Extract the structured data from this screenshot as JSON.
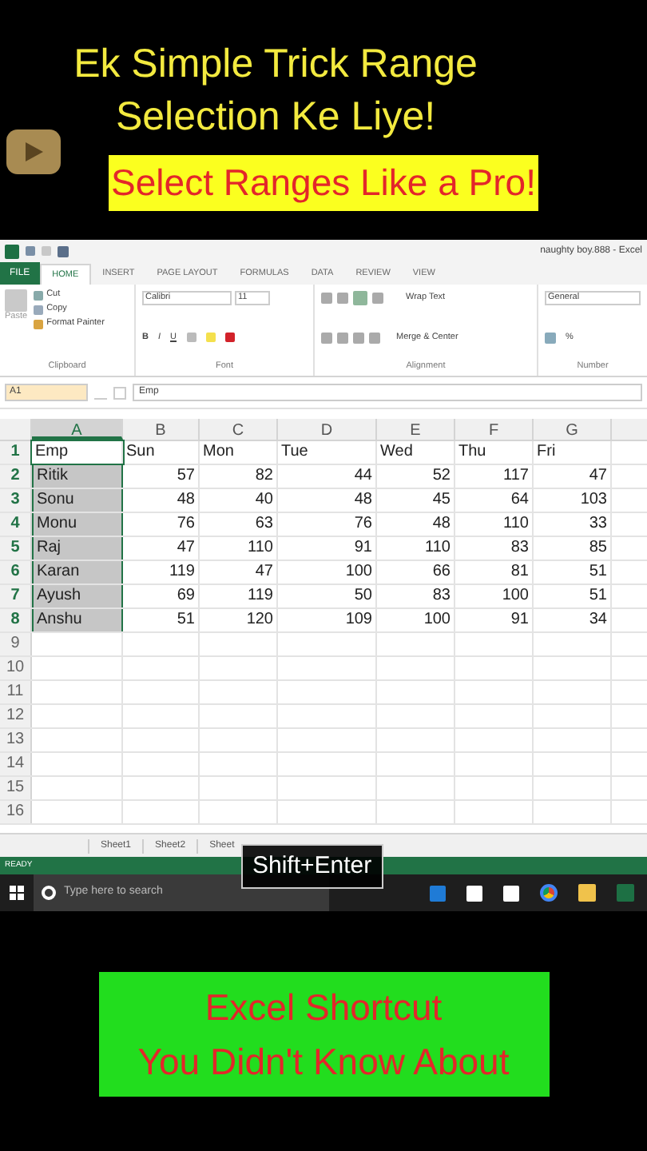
{
  "headline": {
    "lines": [
      "Ek Simple Trick Range",
      "Selection Ke Liye!"
    ]
  },
  "banner": "Select Ranges Like a Pro!",
  "excel": {
    "title": "naughty boy.888 - Excel",
    "tabs": [
      {
        "label": "FILE",
        "kind": "file",
        "selected": false
      },
      {
        "label": "HOME",
        "kind": "tab",
        "selected": true
      },
      {
        "label": "INSERT",
        "kind": "tab",
        "selected": false
      },
      {
        "label": "PAGE LAYOUT",
        "kind": "tab",
        "selected": false
      },
      {
        "label": "FORMULAS",
        "kind": "tab",
        "selected": false
      },
      {
        "label": "DATA",
        "kind": "tab",
        "selected": false
      },
      {
        "label": "REVIEW",
        "kind": "tab",
        "selected": false
      },
      {
        "label": "VIEW",
        "kind": "tab",
        "selected": false
      }
    ],
    "ribbon": {
      "paste": "Paste",
      "cut": "Cut",
      "copy": "Copy",
      "format_painter": "Format Painter",
      "clipboard": "Clipboard",
      "font_name": "Calibri",
      "font_size": "11",
      "bold": "B",
      "italic": "I",
      "underline": "U",
      "font": "Font",
      "wrap_text": "Wrap Text",
      "merge_center": "Merge & Center",
      "alignment": "Alignment",
      "number_format": "General",
      "percent": "%",
      "number": "Number"
    },
    "name_box": "A1",
    "formula": "Emp",
    "columns": [
      {
        "label": "A",
        "selected": true
      },
      {
        "label": "B",
        "selected": false
      },
      {
        "label": "C",
        "selected": false
      },
      {
        "label": "D",
        "selected": false
      },
      {
        "label": "E",
        "selected": false
      },
      {
        "label": "F",
        "selected": false
      },
      {
        "label": "G",
        "selected": false
      }
    ],
    "rows": [
      {
        "number": "1",
        "selected": true,
        "cells": [
          "Emp",
          "Sun",
          "Mon",
          "Tue",
          "Wed",
          "Thu",
          "Fri"
        ]
      },
      {
        "number": "2",
        "selected": true,
        "cells": [
          "Ritik",
          "57",
          "82",
          "44",
          "52",
          "117",
          "47"
        ]
      },
      {
        "number": "3",
        "selected": true,
        "cells": [
          "Sonu",
          "48",
          "40",
          "48",
          "45",
          "64",
          "103"
        ]
      },
      {
        "number": "4",
        "selected": true,
        "cells": [
          "Monu",
          "76",
          "63",
          "76",
          "48",
          "110",
          "33"
        ]
      },
      {
        "number": "5",
        "selected": true,
        "cells": [
          "Raj",
          "47",
          "110",
          "91",
          "110",
          "83",
          "85"
        ]
      },
      {
        "number": "6",
        "selected": true,
        "cells": [
          "Karan",
          "119",
          "47",
          "100",
          "66",
          "81",
          "51"
        ]
      },
      {
        "number": "7",
        "selected": true,
        "cells": [
          "Ayush",
          "69",
          "119",
          "50",
          "83",
          "100",
          "51"
        ]
      },
      {
        "number": "8",
        "selected": true,
        "cells": [
          "Anshu",
          "51",
          "120",
          "109",
          "100",
          "91",
          "34"
        ]
      },
      {
        "number": "9",
        "selected": false,
        "cells": []
      },
      {
        "number": "10",
        "selected": false,
        "cells": []
      },
      {
        "number": "11",
        "selected": false,
        "cells": []
      },
      {
        "number": "12",
        "selected": false,
        "cells": []
      },
      {
        "number": "13",
        "selected": false,
        "cells": []
      },
      {
        "number": "14",
        "selected": false,
        "cells": []
      },
      {
        "number": "15",
        "selected": false,
        "cells": []
      },
      {
        "number": "16",
        "selected": false,
        "cells": []
      }
    ],
    "sheet_tabs": [
      {
        "label": "Sheet1",
        "selected": false
      },
      {
        "label": "Sheet2",
        "selected": false
      },
      {
        "label": "Sheet",
        "selected": false
      }
    ],
    "status": "READY",
    "taskbar": {
      "search_placeholder": "Type here to search"
    }
  },
  "key_overlay": "Shift+Enter",
  "footer": {
    "lines": [
      "Excel Shortcut",
      "You Didn't Know About"
    ]
  }
}
